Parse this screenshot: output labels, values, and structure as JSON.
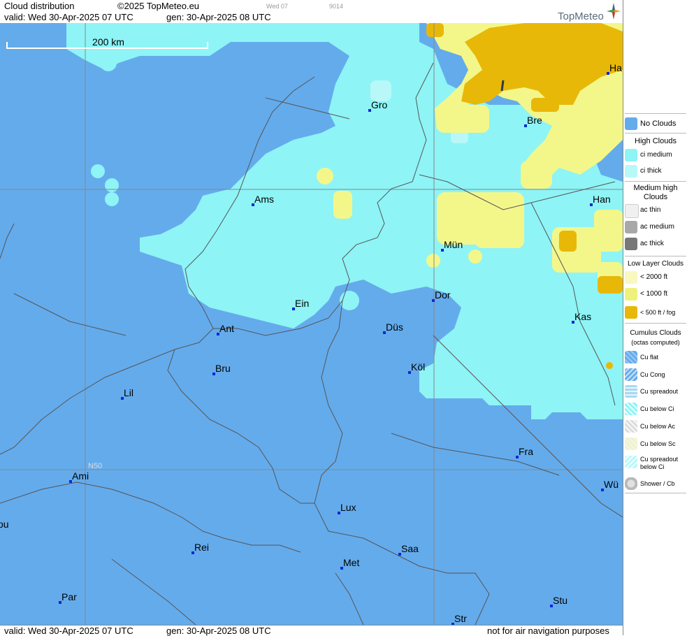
{
  "header": {
    "title": "Cloud distribution",
    "copyright": "©2025 TopMeteo.eu",
    "valid_line": "valid:  Wed  30-Apr-2025  07 UTC",
    "gen_line": "gen: 30-Apr-2025 08 UTC",
    "small_day": "Wed 07",
    "small_code": "9014",
    "brand": "TopMeteo"
  },
  "map": {
    "scale_label": "200 km",
    "grid_label": "N50",
    "cities": [
      {
        "name": "Gro"
      },
      {
        "name": "Bre"
      },
      {
        "name": "Ha"
      },
      {
        "name": "Ams"
      },
      {
        "name": "Han"
      },
      {
        "name": "Mün"
      },
      {
        "name": "Dor"
      },
      {
        "name": "Ein"
      },
      {
        "name": "Ant"
      },
      {
        "name": "Düs"
      },
      {
        "name": "Kas"
      },
      {
        "name": "Bru"
      },
      {
        "name": "Köl"
      },
      {
        "name": "Lil"
      },
      {
        "name": "Fra"
      },
      {
        "name": "Ami"
      },
      {
        "name": "Wü"
      },
      {
        "name": "Lux"
      },
      {
        "name": "Rei"
      },
      {
        "name": "Saa"
      },
      {
        "name": "Met"
      },
      {
        "name": "Par"
      },
      {
        "name": "Stu"
      },
      {
        "name": "Str"
      },
      {
        "name": "ou"
      }
    ]
  },
  "footer": {
    "valid_line": "valid:  Wed  30-Apr-2025  07 UTC",
    "gen_line": "gen: 30-Apr-2025 08 UTC",
    "disclaimer": "not for air navigation purposes"
  },
  "legend": {
    "no_clouds": "No Clouds",
    "high_clouds": "High Clouds",
    "ci_medium": "ci medium",
    "ci_thick": "ci thick",
    "medium_high": "Medium high Clouds",
    "ac_thin": "ac thin",
    "ac_medium": "ac medium",
    "ac_thick": "ac thick",
    "low_layer": "Low Layer Clouds",
    "low_2000": "< 2000 ft",
    "low_1000": "< 1000 ft",
    "low_500": "< 500 ft / fog",
    "cumulus": "Cumulus Clouds",
    "cumulus_sub": "(octas computed)",
    "cu_flat": "Cu flat",
    "cu_cong": "Cu Cong",
    "cu_spreadout": "Cu spreadout",
    "cu_below_ci": "Cu below Ci",
    "cu_below_ac": "Cu below Ac",
    "cu_below_sc": "Cu below Sc",
    "cu_spreadout_below_ci": "Cu spreadout below Ci",
    "shower_cb": "Shower / Cb"
  },
  "colors": {
    "no_clouds": "#64abec",
    "ci_medium": "#8ef4f6",
    "ci_thick": "#b8f8f8",
    "low_2000": "#f3f78a",
    "low_1000": "#eef27a",
    "low_500": "#e8b808",
    "ac_medium": "#a8a8a8",
    "ac_thick": "#787878"
  }
}
